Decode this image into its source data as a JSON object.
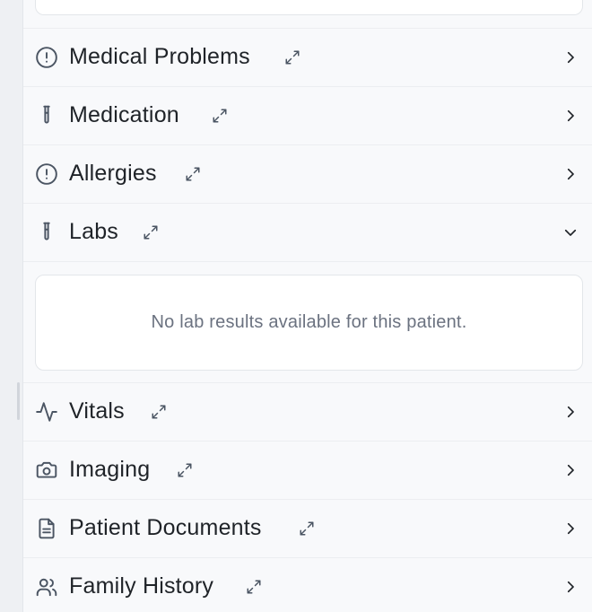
{
  "sections": [
    {
      "label": "Medical Problems",
      "icon": "alert-circle-icon",
      "expanded": false
    },
    {
      "label": "Medication",
      "icon": "test-tube-icon",
      "expanded": false
    },
    {
      "label": "Allergies",
      "icon": "alert-circle-icon",
      "expanded": false
    },
    {
      "label": "Labs",
      "icon": "test-tube-icon",
      "expanded": true
    },
    {
      "label": "Vitals",
      "icon": "activity-icon",
      "expanded": false
    },
    {
      "label": "Imaging",
      "icon": "camera-icon",
      "expanded": false
    },
    {
      "label": "Patient Documents",
      "icon": "file-text-icon",
      "expanded": false
    },
    {
      "label": "Family History",
      "icon": "users-icon",
      "expanded": false
    }
  ],
  "labs": {
    "empty_message": "No lab results available for this patient."
  },
  "colors": {
    "text_primary": "#1f2328",
    "text_muted": "#6b7280",
    "icon": "#4b5563",
    "background": "#f8f9fb",
    "card": "#ffffff",
    "border": "#e3e6ea"
  }
}
